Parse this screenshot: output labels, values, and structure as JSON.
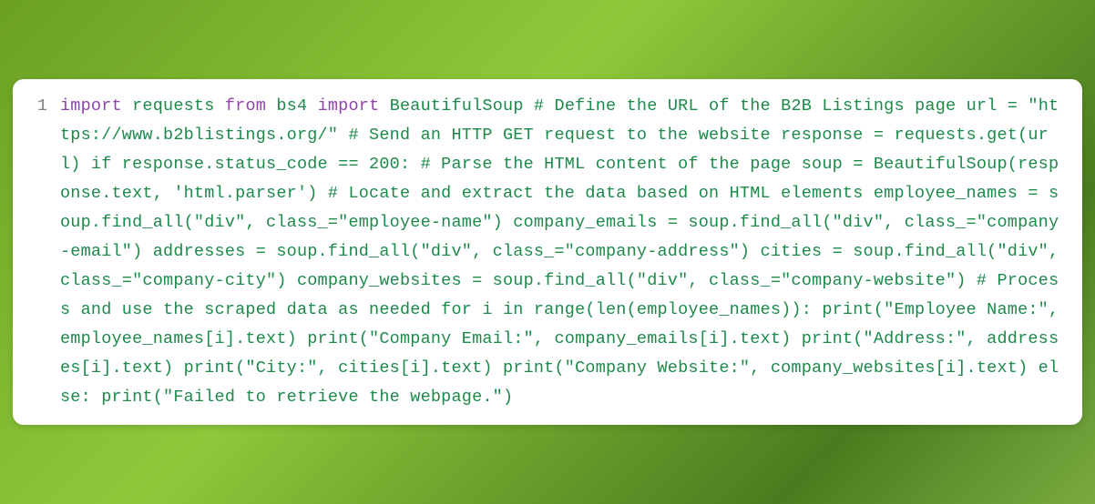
{
  "gutter": {
    "line1": "1"
  },
  "code": {
    "tokens": [
      {
        "t": "import",
        "c": "kw"
      },
      {
        "t": " requests ",
        "c": "plain"
      },
      {
        "t": "from",
        "c": "kw"
      },
      {
        "t": " bs4 ",
        "c": "plain"
      },
      {
        "t": "import",
        "c": "kw"
      },
      {
        "t": " BeautifulSoup # Define the URL of the B2B Listings page url = \"https://www.b2blistings.org/\" # Send an HTTP GET request to the website response = requests.get(url) if response.status_code == 200: # Parse the HTML content of the page soup = BeautifulSoup(response.text, 'html.parser') # Locate and extract the data based on HTML elements employee_names = soup.find_all(\"div\", class_=\"employee-name\") company_emails = soup.find_all(\"div\", class_=\"company-email\") addresses = soup.find_all(\"div\", class_=\"company-address\") cities = soup.find_all(\"div\", class_=\"company-city\") company_websites = soup.find_all(\"div\", class_=\"company-website\") # Process and use the scraped data as needed for i in range(len(employee_names)): print(\"Employee Name:\", employee_names[i].text) print(\"Company Email:\", company_emails[i].text) print(\"Address:\", addresses[i].text) print(\"City:\", cities[i].text) print(\"Company Website:\", company_websites[i].text) else: print(\"Failed to retrieve the webpage.\")",
        "c": "plain"
      }
    ]
  }
}
